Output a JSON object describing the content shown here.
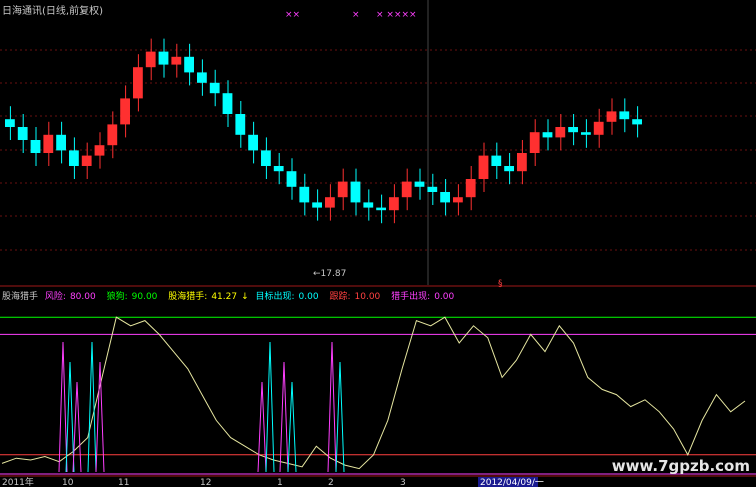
{
  "header": {
    "title": "日海通讯(日线,前复权)"
  },
  "indicator": {
    "name": "股海猎手",
    "items": [
      {
        "label": "风险:",
        "value": "80.00",
        "color": "#ff40ff"
      },
      {
        "label": "狼狗:",
        "value": "90.00",
        "color": "#00ff00"
      },
      {
        "label": "股海猎手:",
        "value": "41.27",
        "color": "#ffff00"
      },
      {
        "label": "目标出现:",
        "value": "0.00",
        "color": "#00ffff"
      },
      {
        "label": "跟踪:",
        "value": "10.00",
        "color": "#ff4040"
      },
      {
        "label": "猎手出现:",
        "value": "0.00",
        "color": "#ff40ff"
      }
    ]
  },
  "markers": {
    "low_price": "←17.87",
    "mid_symbol": "§",
    "top_x_marks": [
      "××",
      "×",
      "× ××××"
    ]
  },
  "watermark": "www.7gpzb.com",
  "colors": {
    "up": "#ff3030",
    "down": "#00ffff",
    "line": "#e6e6a0",
    "risk": "#ff40ff",
    "wolf": "#00ff00",
    "track": "#ff4040"
  },
  "chart_data": [
    {
      "type": "candlestick",
      "title": "日海通讯(日线,前复权)",
      "annotations": [
        "←17.87"
      ],
      "close_trend": [
        22.5,
        22.0,
        21.5,
        22.2,
        21.6,
        21.0,
        21.4,
        21.8,
        22.6,
        23.6,
        24.8,
        25.4,
        24.9,
        25.2,
        24.6,
        24.2,
        23.8,
        23.0,
        22.2,
        21.6,
        21.0,
        20.8,
        20.2,
        19.6,
        19.4,
        19.8,
        20.4,
        19.6,
        19.4,
        19.3,
        19.8,
        20.4,
        20.2,
        20.0,
        19.6,
        19.8,
        20.5,
        21.4,
        21.0,
        20.8,
        21.5,
        22.3,
        22.1,
        22.5,
        22.3,
        22.2,
        22.7,
        23.1,
        22.8,
        22.6
      ]
    },
    {
      "type": "line",
      "title": "股海猎手",
      "series": [
        {
          "name": "风险",
          "values": [
            80.0
          ]
        },
        {
          "name": "狼狗",
          "values": [
            90.0
          ]
        },
        {
          "name": "股海猎手",
          "values": [
            5,
            8,
            7,
            9,
            6,
            12,
            20,
            55,
            90,
            85,
            88,
            80,
            70,
            60,
            45,
            30,
            20,
            15,
            10,
            7,
            5,
            3,
            15,
            8,
            4,
            2,
            10,
            30,
            60,
            88,
            85,
            90,
            75,
            85,
            78,
            55,
            65,
            80,
            70,
            85,
            75,
            55,
            48,
            45,
            38,
            42,
            35,
            25,
            10,
            30,
            45,
            35,
            41.27
          ]
        },
        {
          "name": "目标出现",
          "values": [
            0.0
          ]
        },
        {
          "name": "跟踪",
          "values": [
            10.0
          ]
        },
        {
          "name": "猎手出现",
          "values": [
            0.0
          ]
        }
      ],
      "ylim": [
        0,
        100
      ]
    }
  ],
  "xaxis": {
    "ticks": [
      "2011年",
      "10",
      "11",
      "12",
      "1",
      "2",
      "3"
    ],
    "cursor_date": "2012/04/09/一"
  }
}
